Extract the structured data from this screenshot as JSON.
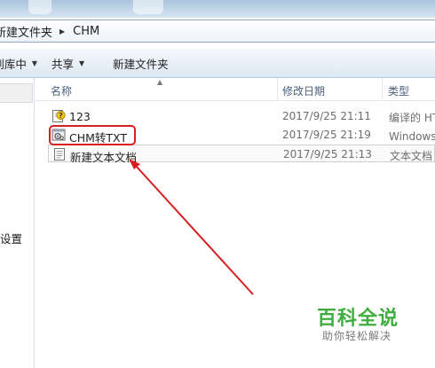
{
  "breadcrumb": {
    "parent": "新建文件夹",
    "current": "CHM"
  },
  "toolbar": {
    "include_library": "包含到库中",
    "share": "共享",
    "new_folder": "新建文件夹"
  },
  "nav": {
    "item_partial": "设置"
  },
  "columns": {
    "name": "名称",
    "date": "修改日期",
    "type": "类型"
  },
  "files": [
    {
      "name": "123",
      "date": "2017/9/25 21:11",
      "type": "编译的 HTML 帮助文件",
      "icon": "chm-help-file-icon"
    },
    {
      "name": "CHM转TXT",
      "date": "2017/9/25 21:19",
      "type": "Windows 批处理文件",
      "icon": "batch-file-gear-icon"
    },
    {
      "name": "新建文本文档",
      "date": "2017/9/25 21:13",
      "type": "文本文档",
      "icon": "text-document-icon"
    }
  ],
  "watermark": {
    "title": "百科全说",
    "subtitle": "助你轻松解决"
  },
  "colors": {
    "annotation": "#d81e1e",
    "watermark_green": "#3fae3f"
  }
}
